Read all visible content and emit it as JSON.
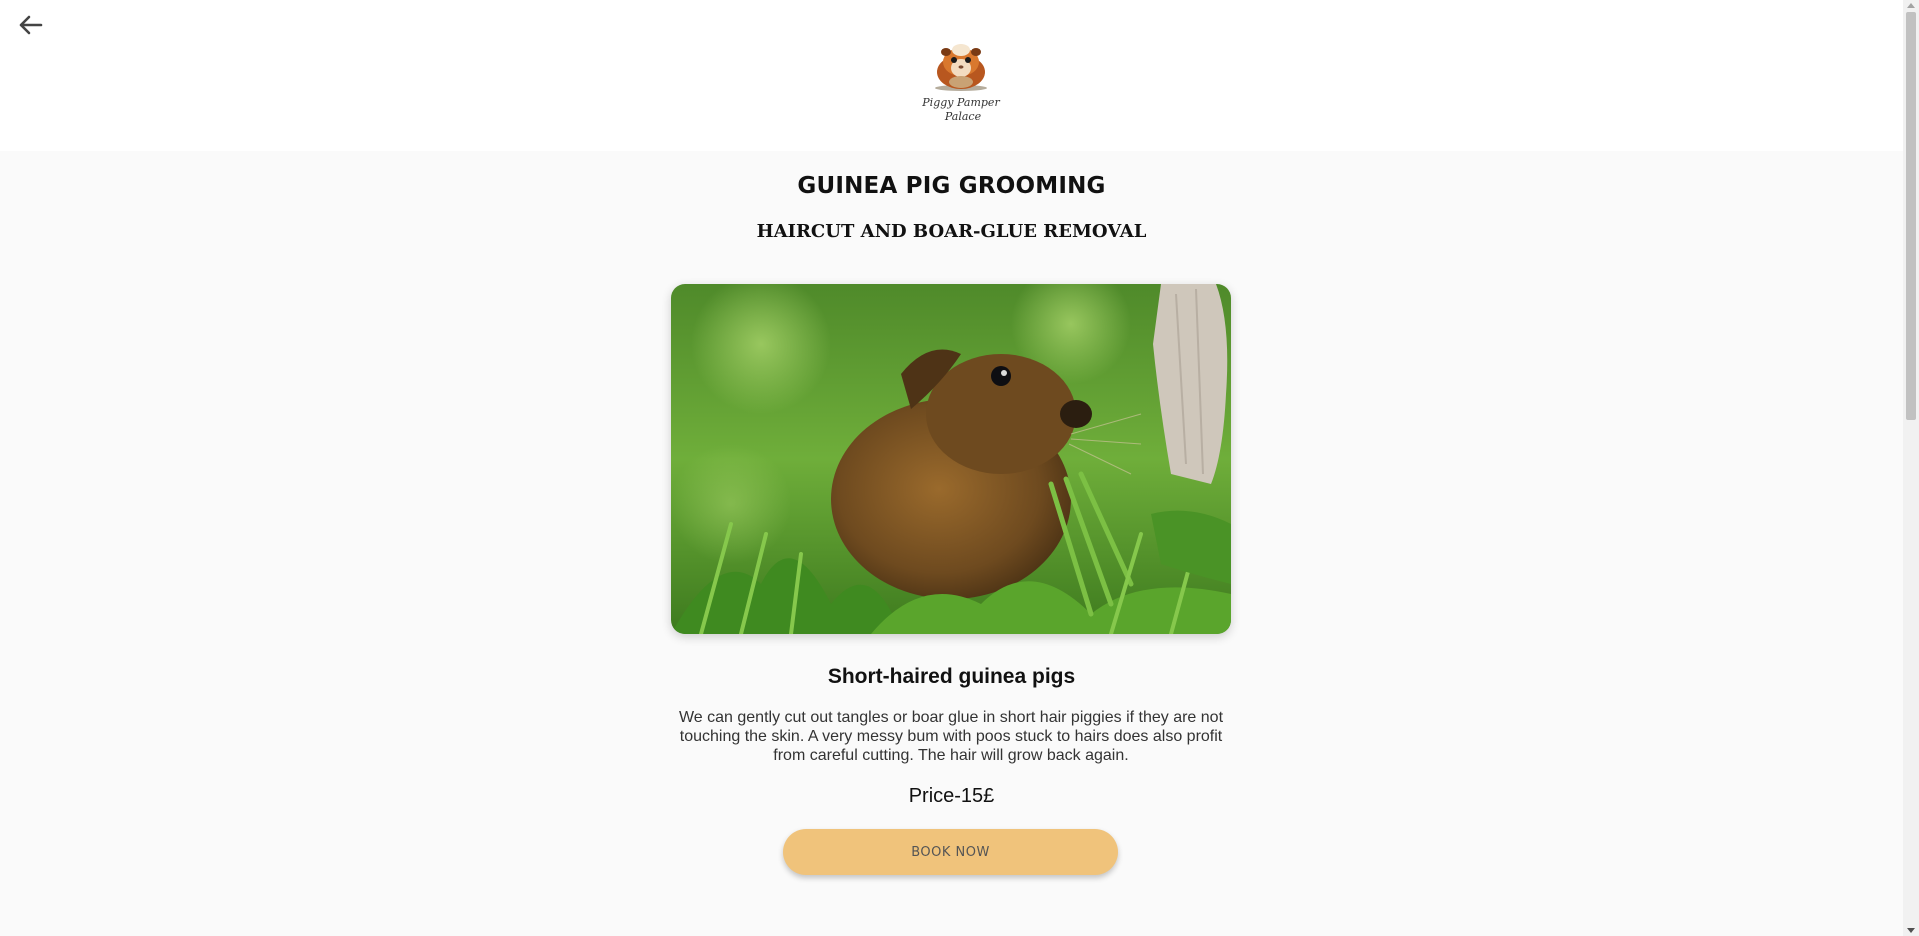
{
  "header": {
    "back_icon": "arrow-left-icon",
    "logo_text_line1": "Piggy Pamper",
    "logo_text_line2": "Palace"
  },
  "page": {
    "title": "GUINEA PIG GROOMING",
    "subtitle": "HAIRCUT AND BOAR-GLUE REMOVAL"
  },
  "service": {
    "image_subject": "guinea-pig-in-grass",
    "heading": "Short-haired guinea pigs",
    "description": "We can gently cut out tangles or boar glue in short hair piggies if they are not touching the skin. A very messy bum with poos stuck to hairs does also profit from careful cutting. The hair will grow back again.",
    "price": "Price-15£",
    "book_label": "BOOK NOW"
  },
  "colors": {
    "accent": "#f0c37b",
    "background": "#fafafa",
    "header_bg": "#ffffff"
  }
}
